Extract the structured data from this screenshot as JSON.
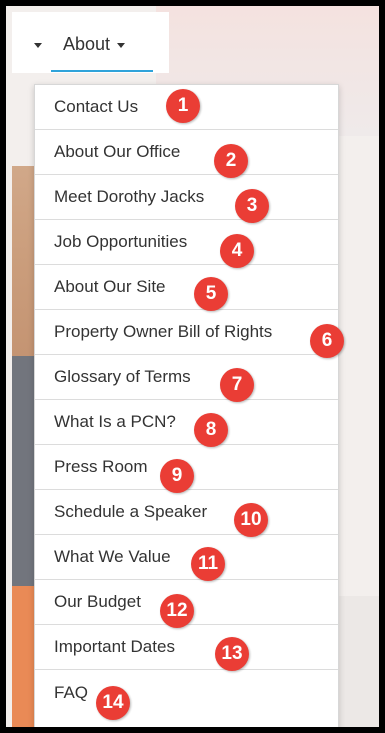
{
  "nav": {
    "about_label": "About"
  },
  "menu": {
    "items": [
      {
        "label": "Contact Us",
        "number": "1"
      },
      {
        "label": "About Our Office",
        "number": "2"
      },
      {
        "label": "Meet Dorothy Jacks",
        "number": "3"
      },
      {
        "label": "Job Opportunities",
        "number": "4"
      },
      {
        "label": "About Our Site",
        "number": "5"
      },
      {
        "label": "Property Owner Bill of Rights",
        "number": "6"
      },
      {
        "label": "Glossary of Terms",
        "number": "7"
      },
      {
        "label": "What Is a PCN?",
        "number": "8"
      },
      {
        "label": "Press Room",
        "number": "9"
      },
      {
        "label": "Schedule a Speaker",
        "number": "10"
      },
      {
        "label": "What We Value",
        "number": "11"
      },
      {
        "label": "Our Budget",
        "number": "12"
      },
      {
        "label": "Important Dates",
        "number": "13"
      },
      {
        "label": "FAQ",
        "number": "14"
      }
    ]
  },
  "colors": {
    "accent": "#2fa3da",
    "badge": "#ea3d35",
    "text": "#333333",
    "divider": "#dcdcdc"
  },
  "icons": {
    "caret": "caret-down-icon"
  }
}
